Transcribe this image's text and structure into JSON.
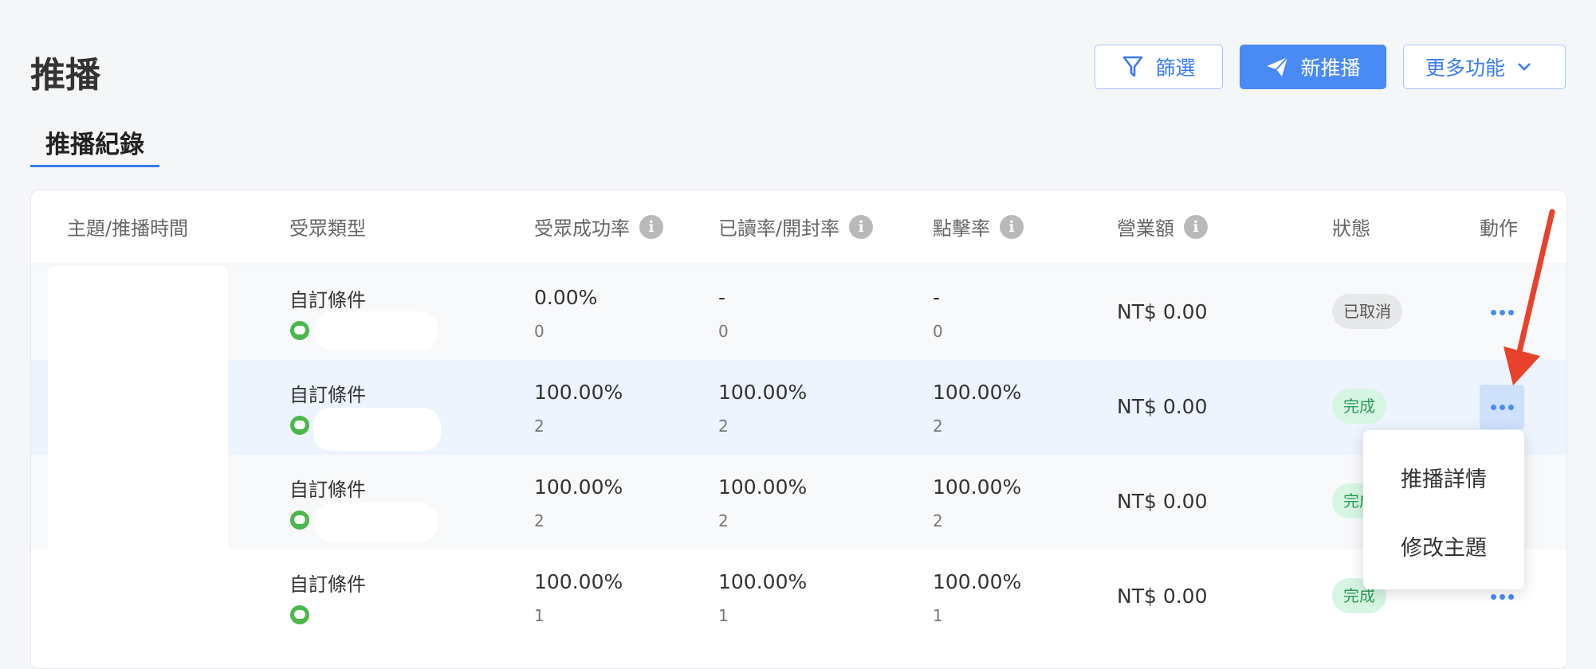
{
  "header": {
    "title": "推播",
    "filter_label": "篩選",
    "new_push_label": "新推播",
    "more_label": "更多功能"
  },
  "tabs": [
    {
      "label": "推播紀錄",
      "active": true
    }
  ],
  "table": {
    "columns": [
      "主題/推播時間",
      "受眾類型",
      "受眾成功率",
      "已讀率/開封率",
      "點擊率",
      "營業額",
      "狀態",
      "動作"
    ],
    "rows": [
      {
        "audience_type": "自訂條件",
        "success_rate": "0.00%",
        "success_count": "0",
        "read_rate": "-",
        "read_count": "0",
        "click_rate": "-",
        "click_count": "0",
        "revenue": "NT$ 0.00",
        "status": "已取消"
      },
      {
        "audience_type": "自訂條件",
        "success_rate": "100.00%",
        "success_count": "2",
        "read_rate": "100.00%",
        "read_count": "2",
        "click_rate": "100.00%",
        "click_count": "2",
        "revenue": "NT$ 0.00",
        "status": "完成"
      },
      {
        "audience_type": "自訂條件",
        "success_rate": "100.00%",
        "success_count": "2",
        "read_rate": "100.00%",
        "read_count": "2",
        "click_rate": "100.00%",
        "click_count": "2",
        "revenue": "NT$ 0.00",
        "status": "完成"
      },
      {
        "audience_type": "自訂條件",
        "success_rate": "100.00%",
        "success_count": "1",
        "read_rate": "100.00%",
        "read_count": "1",
        "click_rate": "100.00%",
        "click_count": "1",
        "revenue": "NT$ 0.00",
        "status": "完成"
      }
    ]
  },
  "action_menu": {
    "items": [
      "推播詳情",
      "修改主題"
    ]
  },
  "colors": {
    "primary": "#4a8af4",
    "annotation_arrow": "#e8412c",
    "status_done_bg": "#d6f5e3",
    "status_cancel_bg": "#e7e8ea"
  }
}
